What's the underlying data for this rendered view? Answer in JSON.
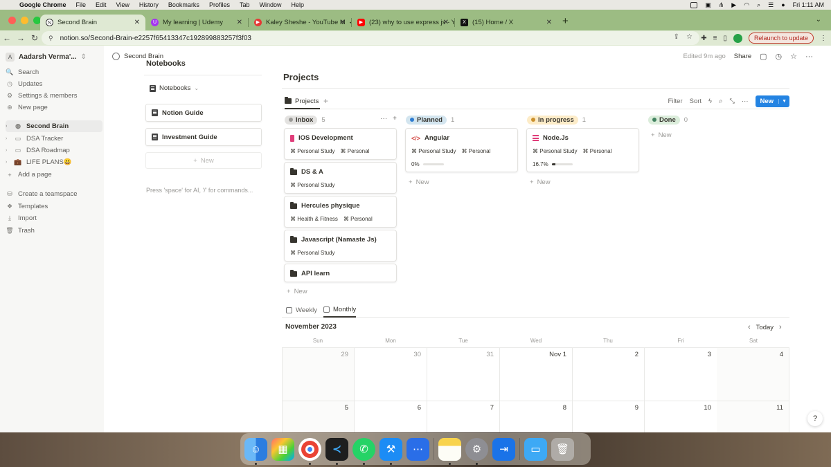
{
  "menubar": {
    "apple": "",
    "items": [
      "Google Chrome",
      "File",
      "Edit",
      "View",
      "History",
      "Bookmarks",
      "Profiles",
      "Tab",
      "Window",
      "Help"
    ],
    "clock": "Fri 1:11 AM"
  },
  "tabs": [
    {
      "title": "Second Brain",
      "close": "✕"
    },
    {
      "title": "My learning | Udemy",
      "close": "✕"
    },
    {
      "title": "Kaley Sheshe - YouTube M",
      "close": "✕"
    },
    {
      "title": "(23) why to use express js - Y",
      "close": "✕"
    },
    {
      "title": "(15) Home / X",
      "close": "✕"
    }
  ],
  "toolbar": {
    "url": "notion.so/Second-Brain-e2257f65413347c192899883257f3f03",
    "relaunch": "Relaunch to update"
  },
  "sidebar": {
    "workspace_initial": "A",
    "workspace": "Aadarsh Verma'...",
    "nav": [
      {
        "label": "Search",
        "icon": "🔍"
      },
      {
        "label": "Updates",
        "icon": "◷"
      },
      {
        "label": "Settings & members",
        "icon": "⚙"
      },
      {
        "label": "New page",
        "icon": "⊕"
      }
    ],
    "pages": [
      {
        "label": "Second Brain",
        "icon": "◍"
      },
      {
        "label": "DSA Tracker",
        "icon": "▭"
      },
      {
        "label": "DSA Roadmap",
        "icon": "▭"
      },
      {
        "label": "LIFE PLANS😃",
        "icon": "💼"
      }
    ],
    "add_page": "Add a page",
    "bottom": [
      {
        "label": "Create a teamspace",
        "icon": "⛁"
      },
      {
        "label": "Templates",
        "icon": "❖"
      },
      {
        "label": "Import",
        "icon": "⤓"
      },
      {
        "label": "Trash",
        "icon": "🗑"
      }
    ]
  },
  "topbar": {
    "breadcrumb": "Second Brain",
    "edited": "Edited 9m ago",
    "share": "Share"
  },
  "notebooks": {
    "heading": "Notebooks",
    "toggle_label": "Notebooks",
    "cards": [
      "Notion Guide",
      "Investment Guide"
    ],
    "new_label": "New",
    "hint": "Press 'space' for AI, '/' for commands..."
  },
  "projects": {
    "title": "Projects",
    "view_tab": "Projects",
    "tools": {
      "filter": "Filter",
      "sort": "Sort",
      "new": "New"
    },
    "columns": [
      {
        "name": "Inbox",
        "count": "5",
        "color": "#9b9a97",
        "bg": "#e3e2e0"
      },
      {
        "name": "Planned",
        "count": "1",
        "color": "#2e7cd1",
        "bg": "#d3e5ef"
      },
      {
        "name": "In progress",
        "count": "1",
        "color": "#cb912f",
        "bg": "#fdecc8"
      },
      {
        "name": "Done",
        "count": "0",
        "color": "#448361",
        "bg": "#dbeddb"
      }
    ],
    "inbox_cards": [
      {
        "title": "IOS Development",
        "tags": [
          "Personal Study",
          "Personal"
        ]
      },
      {
        "title": "DS & A",
        "tags": [
          "Personal Study"
        ]
      },
      {
        "title": "Hercules physique",
        "tags": [
          "Health & Fitness",
          "Personal"
        ]
      },
      {
        "title": "Javascript (Namaste Js)",
        "tags": [
          "Personal Study"
        ]
      },
      {
        "title": "API learn",
        "tags": []
      }
    ],
    "planned_cards": [
      {
        "title": "Angular",
        "tags": [
          "Personal Study",
          "Personal"
        ],
        "progress_label": "0%",
        "progress": 0
      }
    ],
    "inprogress_cards": [
      {
        "title": "Node.Js",
        "tags": [
          "Personal Study",
          "Personal"
        ],
        "progress_label": "16.7%",
        "progress": 0.167
      }
    ],
    "new_label": "New"
  },
  "calendar": {
    "tabs": [
      "Weekly",
      "Monthly"
    ],
    "month": "November 2023",
    "today": "Today",
    "weekdays": [
      "Sun",
      "Mon",
      "Tue",
      "Wed",
      "Thu",
      "Fri",
      "Sat"
    ],
    "week1": [
      "29",
      "30",
      "31",
      "Nov 1",
      "2",
      "3",
      "4"
    ],
    "week2": [
      "5",
      "6",
      "7",
      "8",
      "9",
      "10",
      "11"
    ]
  },
  "help": "?"
}
